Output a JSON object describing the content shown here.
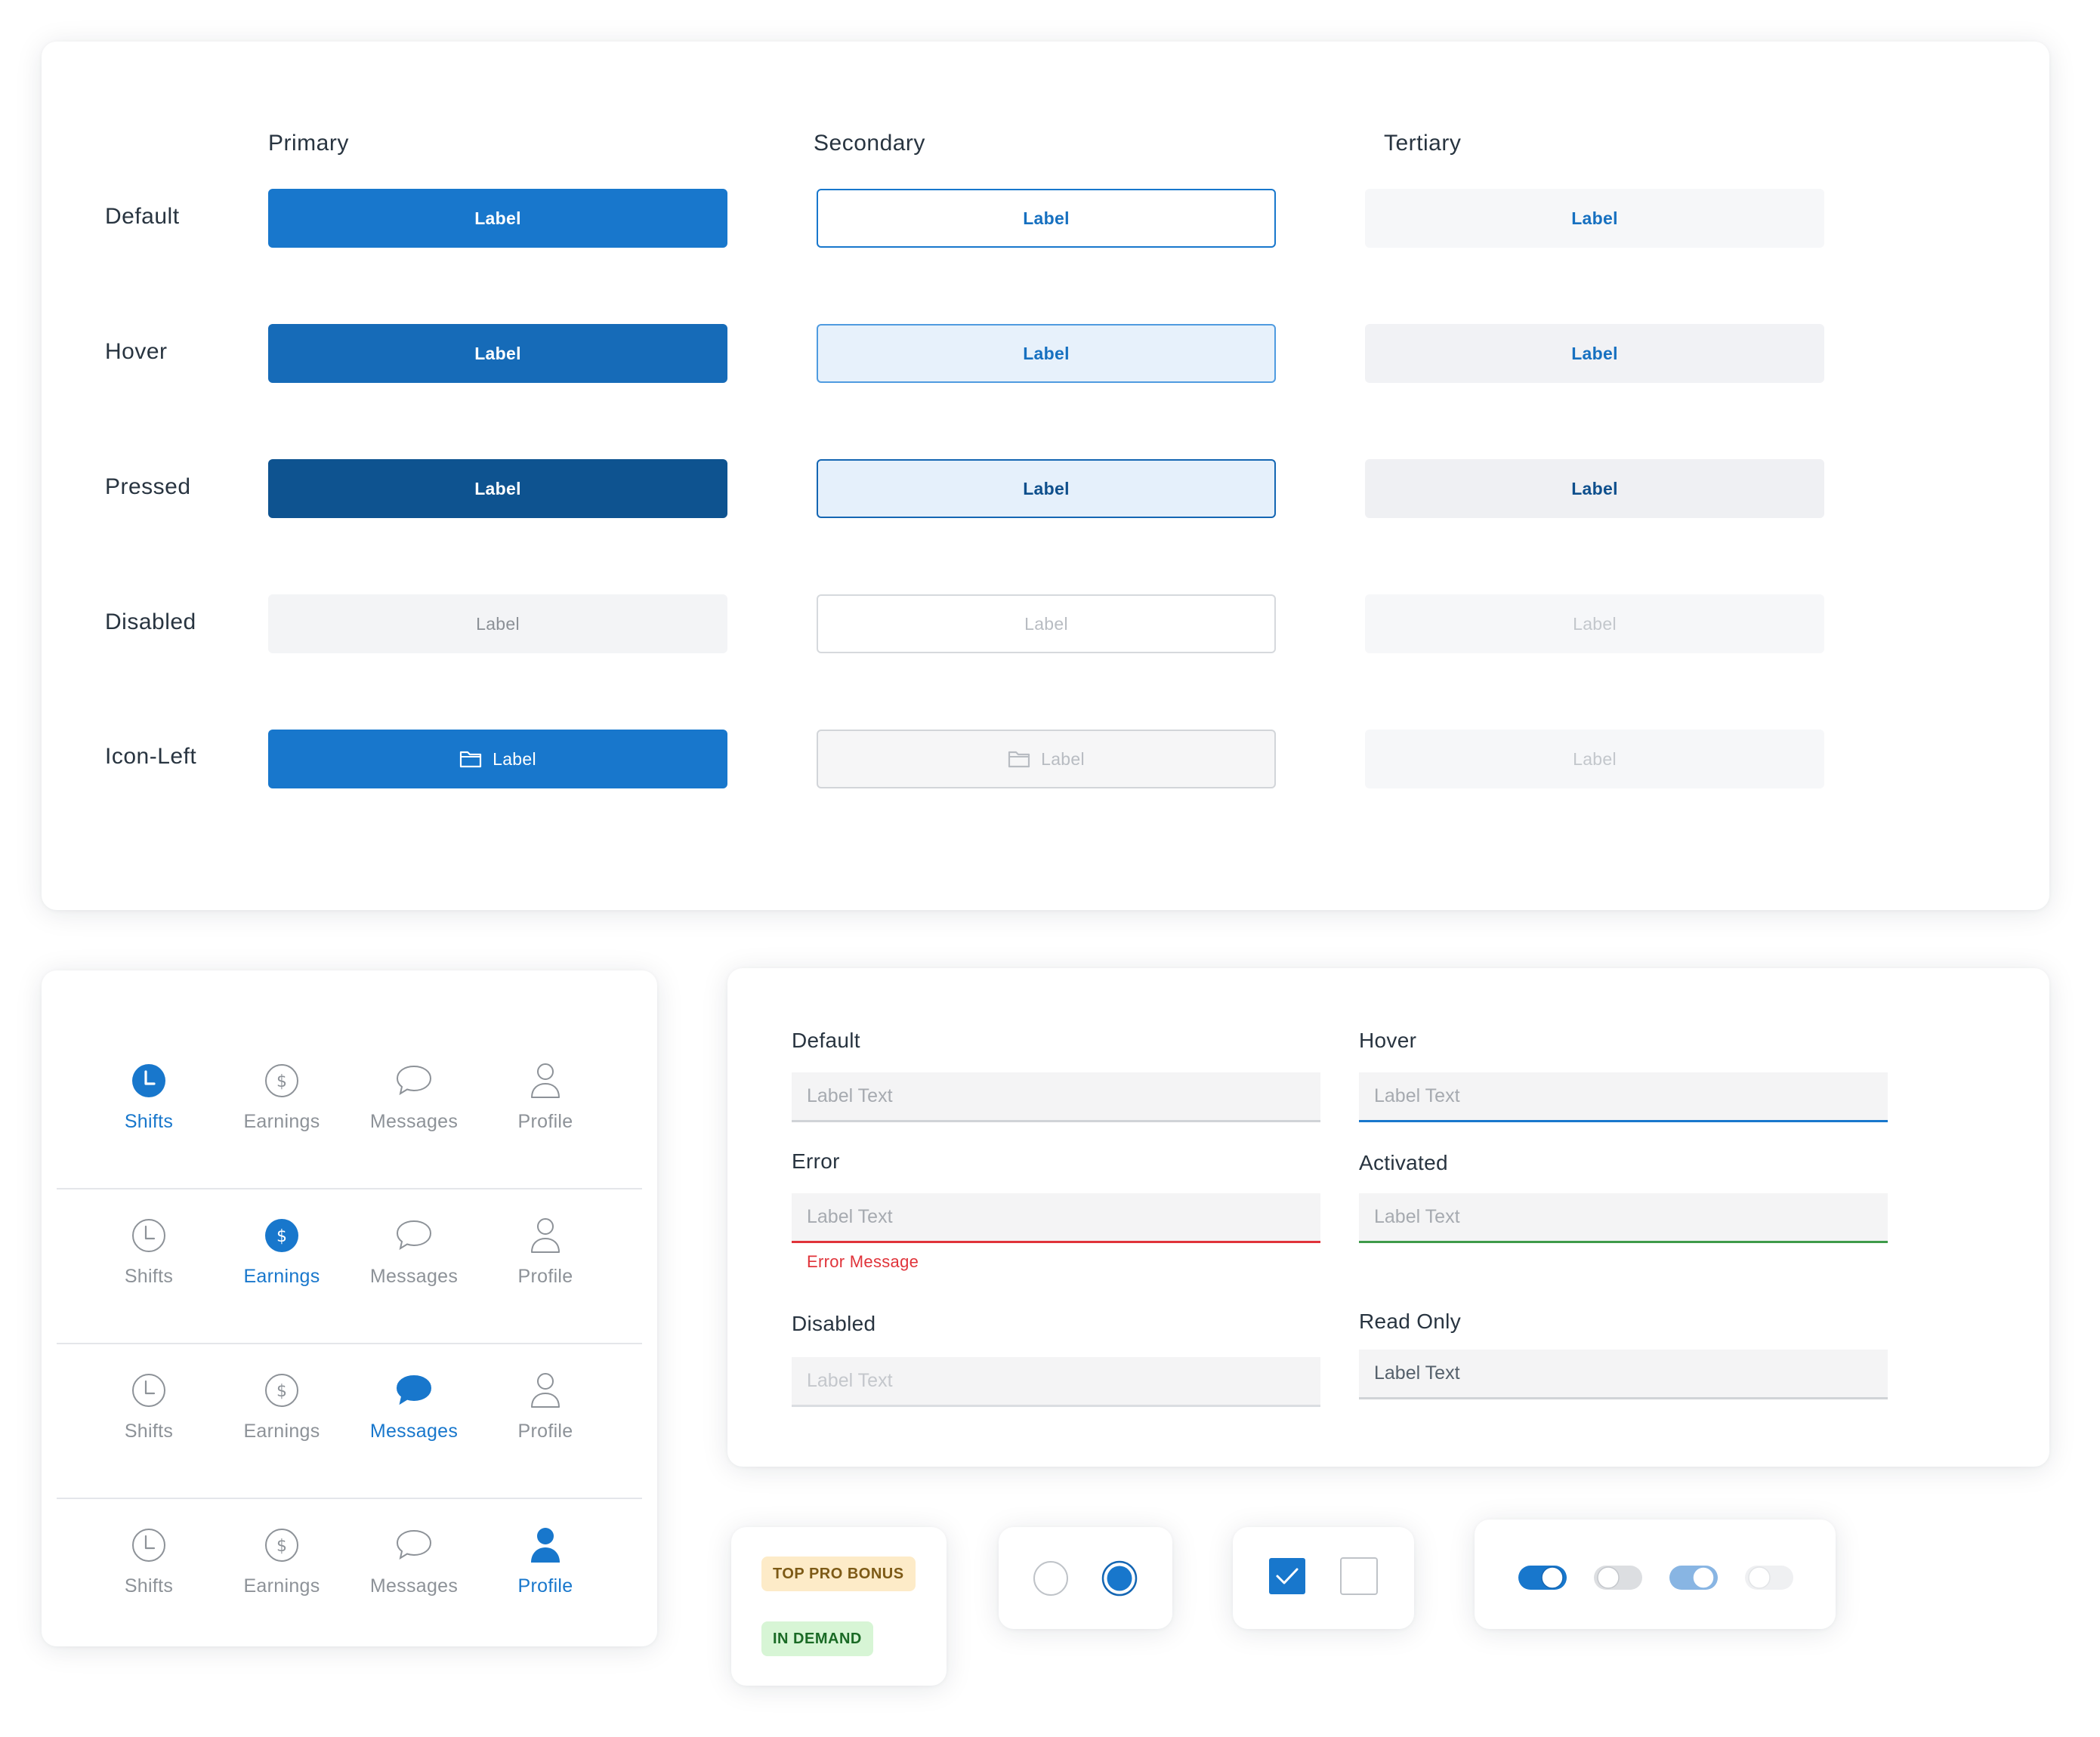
{
  "buttons": {
    "columns": [
      "Primary",
      "Secondary",
      "Tertiary"
    ],
    "rows": [
      "Default",
      "Hover",
      "Pressed",
      "Disabled",
      "Icon-Left"
    ],
    "label": "Label",
    "icon_left": "folder-icon"
  },
  "bottom_nav": {
    "items": [
      {
        "label": "Shifts",
        "icon": "clock-icon"
      },
      {
        "label": "Earnings",
        "icon": "dollar-icon"
      },
      {
        "label": "Messages",
        "icon": "chat-bubble-icon"
      },
      {
        "label": "Profile",
        "icon": "person-icon"
      }
    ],
    "active_per_row": [
      "Shifts",
      "Earnings",
      "Messages",
      "Profile"
    ]
  },
  "inputs": {
    "default": {
      "label": "Default",
      "placeholder": "Label Text"
    },
    "hover": {
      "label": "Hover",
      "placeholder": "Label Text"
    },
    "error": {
      "label": "Error",
      "placeholder": "Label Text",
      "message": "Error Message"
    },
    "activated": {
      "label": "Activated",
      "placeholder": "Label Text"
    },
    "disabled": {
      "label": "Disabled",
      "placeholder": "Label Text"
    },
    "readonly": {
      "label": "Read Only",
      "value": "Label Text"
    }
  },
  "badges": {
    "top_pro_bonus": "TOP PRO BONUS",
    "in_demand": "IN DEMAND"
  },
  "radios": {
    "unselected": false,
    "selected": true
  },
  "checkboxes": {
    "checked": true,
    "unchecked": false
  },
  "toggles": [
    {
      "state": "on",
      "enabled": true
    },
    {
      "state": "off",
      "enabled": true
    },
    {
      "state": "on",
      "enabled": false
    },
    {
      "state": "off",
      "enabled": false
    }
  ],
  "colors": {
    "primary": "#1877cc",
    "primary_hover": "#166bb8",
    "primary_pressed": "#0e5390",
    "error": "#e0333a",
    "success": "#3e9b4a",
    "text": "#283440",
    "muted": "#8d9298",
    "badge_bonus_bg": "#fdebc8",
    "badge_demand_bg": "#d7f5d5"
  }
}
